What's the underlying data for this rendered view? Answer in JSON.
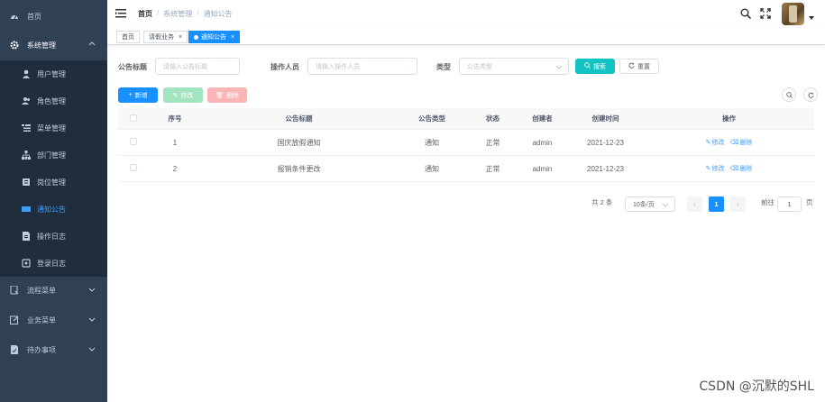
{
  "sidebar": {
    "items": [
      {
        "label": "首页",
        "icon": "dashboard-icon"
      },
      {
        "label": "系统管理",
        "icon": "gear-icon"
      },
      {
        "label": "流程菜单",
        "icon": "flow-icon"
      },
      {
        "label": "业务菜单",
        "icon": "edit-icon"
      },
      {
        "label": "待办事项",
        "icon": "todo-icon"
      }
    ],
    "submenu": [
      {
        "label": "用户管理",
        "icon": "user-icon"
      },
      {
        "label": "角色管理",
        "icon": "peoples-icon"
      },
      {
        "label": "菜单管理",
        "icon": "tree-table-icon"
      },
      {
        "label": "部门管理",
        "icon": "tree-icon"
      },
      {
        "label": "岗位管理",
        "icon": "post-icon"
      },
      {
        "label": "通知公告",
        "icon": "message-icon"
      },
      {
        "label": "操作日志",
        "icon": "form-icon"
      },
      {
        "label": "登录日志",
        "icon": "logininfor-icon"
      }
    ]
  },
  "header": {
    "breadcrumb": [
      "首页",
      "系统管理",
      "通知公告"
    ]
  },
  "tags": [
    {
      "label": "首页"
    },
    {
      "label": "请假业务"
    },
    {
      "label": "通知公告"
    }
  ],
  "search": {
    "title_label": "公告标题",
    "title_placeholder": "请输入公告标题",
    "operator_label": "操作人员",
    "operator_placeholder": "请输入操作人员",
    "type_label": "类型",
    "type_placeholder": "公告类型",
    "search_btn": "搜索",
    "reset_btn": "重置"
  },
  "toolbar": {
    "add": "新增",
    "edit": "修改",
    "delete": "删除"
  },
  "table": {
    "headers": [
      "序号",
      "公告标题",
      "公告类型",
      "状态",
      "创建者",
      "创建时间",
      "操作"
    ],
    "rows": [
      {
        "no": "1",
        "title": "国庆放假通知",
        "type": "通知",
        "status": "正常",
        "creator": "admin",
        "time": "2021-12-23",
        "edit": "修改",
        "delete": "删除"
      },
      {
        "no": "2",
        "title": "报销条件更改",
        "type": "通知",
        "status": "正常",
        "creator": "admin",
        "time": "2021-12-23",
        "edit": "修改",
        "delete": "删除"
      }
    ]
  },
  "pagination": {
    "total": "共 2 条",
    "page_size": "10条/页",
    "current": "1",
    "goto_label": "前往",
    "goto_value": "1",
    "page_suffix": "页"
  },
  "watermark": "CSDN @沉默的SHL",
  "colors": {
    "sidebar": "#304156",
    "primary": "#1890ff",
    "search": "#13c2c2"
  }
}
